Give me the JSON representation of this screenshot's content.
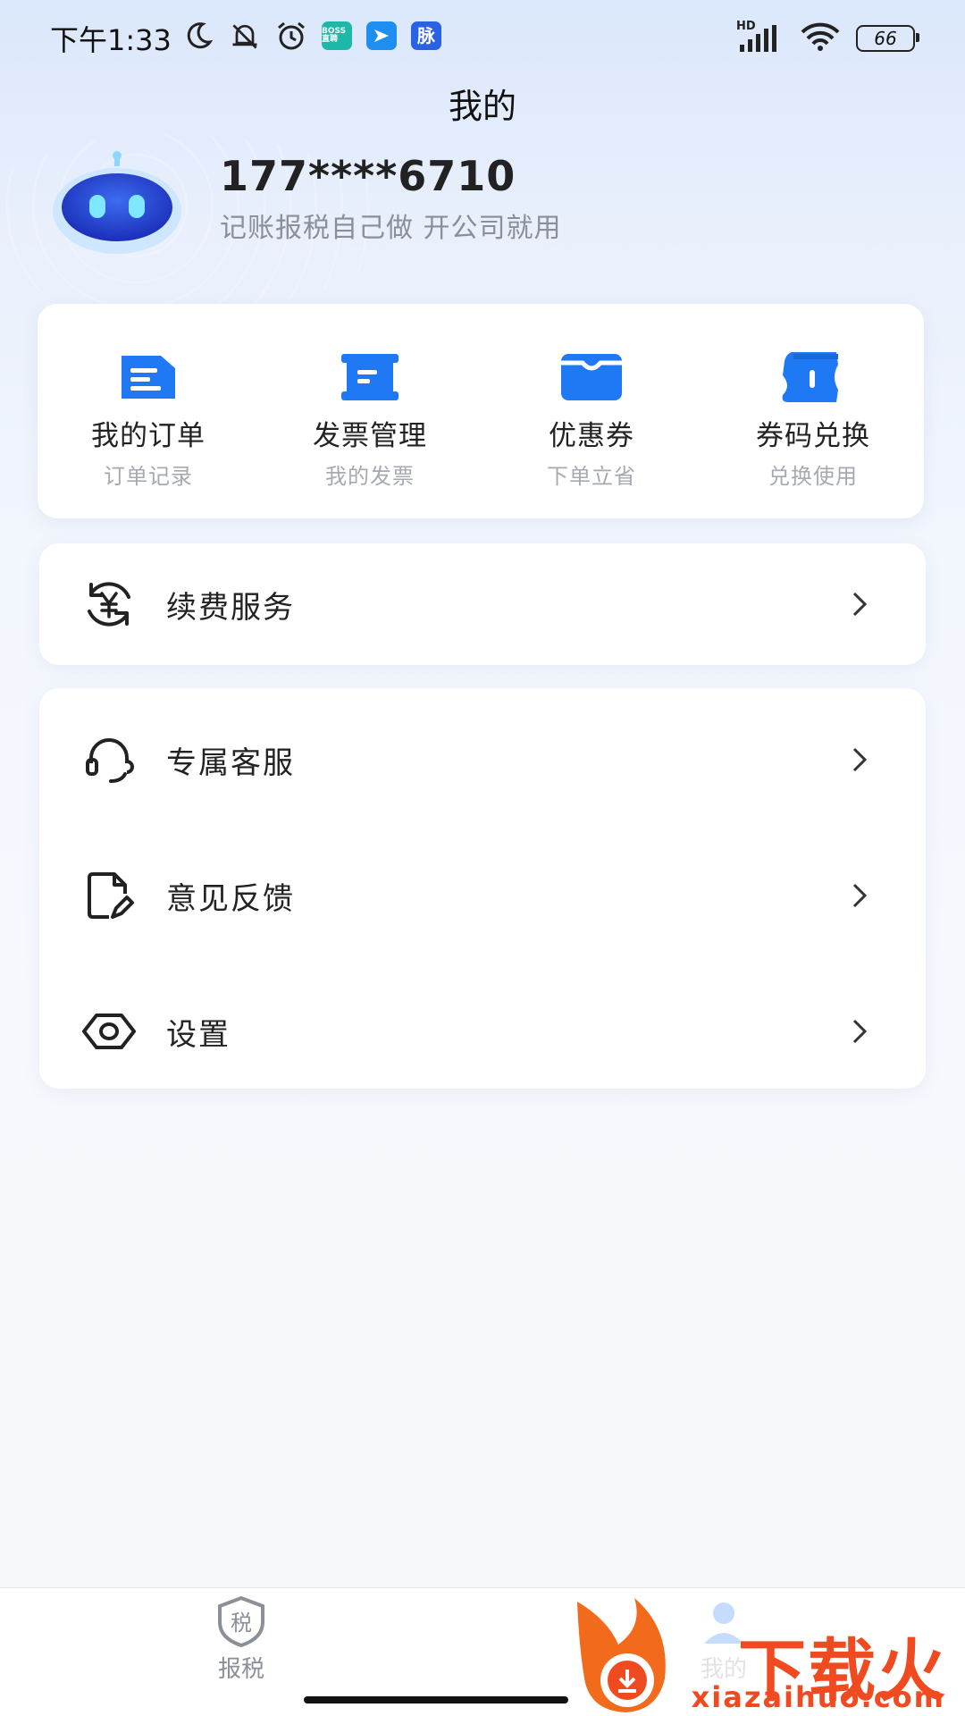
{
  "status_bar": {
    "time": "下午1:33",
    "icons": [
      "moon-icon",
      "mute-icon",
      "alarm-icon",
      "boss-app-icon",
      "feishu-app-icon",
      "maimai-app-icon"
    ],
    "boss_badge": "BOSS直聘",
    "maimai_badge": "脉",
    "network": "HD",
    "battery": "66"
  },
  "header": {
    "title": "我的"
  },
  "profile": {
    "phone": "177****6710",
    "slogan": "记账报税自己做 开公司就用"
  },
  "quick_actions": [
    {
      "label": "我的订单",
      "sub": "订单记录",
      "icon": "order-icon"
    },
    {
      "label": "发票管理",
      "sub": "我的发票",
      "icon": "invoice-icon"
    },
    {
      "label": "优惠券",
      "sub": "下单立省",
      "icon": "coupon-icon"
    },
    {
      "label": "券码兑换",
      "sub": "兑换使用",
      "icon": "ticket-icon"
    }
  ],
  "menu": {
    "renewal": {
      "label": "续费服务",
      "icon": "yuan-cycle-icon"
    },
    "items": [
      {
        "label": "专属客服",
        "icon": "headset-icon"
      },
      {
        "label": "意见反馈",
        "icon": "feedback-icon"
      },
      {
        "label": "设置",
        "icon": "settings-eye-icon"
      }
    ]
  },
  "tabbar": {
    "tabs": [
      {
        "label": "报税",
        "icon_text": "税",
        "icon": "tax-shield-icon"
      },
      {
        "label": "我的",
        "icon": "profile-icon"
      }
    ]
  },
  "watermark": {
    "text": "下载火",
    "url": "xiazaihuo.com"
  },
  "colors": {
    "accent": "#1f7ef5",
    "text": "#222222",
    "subtext": "#a5a9b2",
    "watermark": "#ef4a20"
  }
}
